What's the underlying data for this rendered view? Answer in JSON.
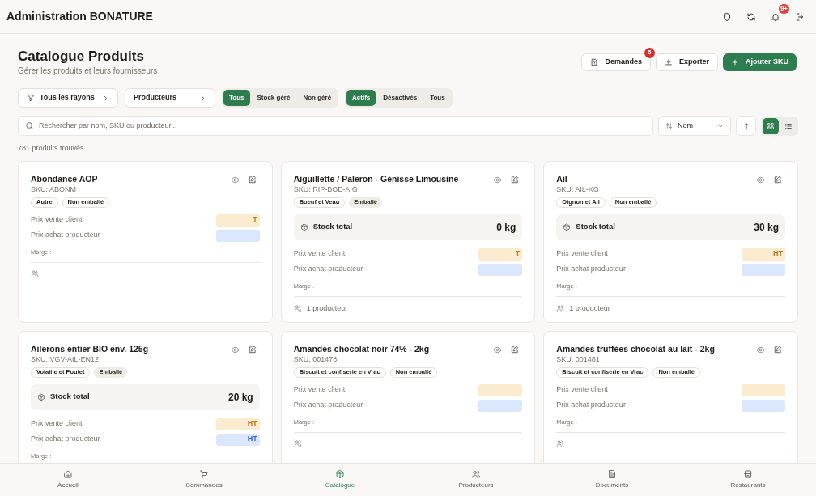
{
  "app_bar": {
    "title": "Administration BONATURE",
    "icons": [
      {
        "kind": "shield"
      },
      {
        "kind": "refresh"
      },
      {
        "kind": "bell",
        "badge": "9+"
      },
      {
        "kind": "logout"
      }
    ]
  },
  "page": {
    "title": "Catalogue Produits",
    "subtitle": "Gérer les produits et leurs fournisseurs"
  },
  "actions": [
    {
      "kind": "demandes",
      "label": "Demandes",
      "badge": "5"
    },
    {
      "kind": "export",
      "label": "Exporter"
    },
    {
      "kind": "add",
      "label": "Ajouter SKU"
    }
  ],
  "filters": {
    "dropdowns": [
      {
        "kind": "filter",
        "label": "Tous les rayons"
      },
      {
        "kind": "plain",
        "label": "Producteurs"
      }
    ],
    "stock_toggle": [
      {
        "label": "Tous",
        "selected": true
      },
      {
        "label": "Stock géré",
        "selected": false
      },
      {
        "label": "Non géré",
        "selected": false
      }
    ],
    "status_toggle": [
      {
        "label": "Actifs",
        "selected": true
      },
      {
        "label": "Désactivés",
        "selected": false
      },
      {
        "label": "Tous",
        "selected": false
      }
    ]
  },
  "search": {
    "placeholder": "Rechercher par nom, SKU ou producteur..."
  },
  "sort": {
    "value": "Nom"
  },
  "view": [
    {
      "kind": "grid",
      "selected": true
    },
    {
      "kind": "list",
      "selected": false
    }
  ],
  "result_count": "781 produits trouvés",
  "products": [
    {
      "name": "Abondance AOP",
      "sku": "SKU: ABONM",
      "tags": [
        {
          "label": "Autre",
          "kind": "outline"
        },
        {
          "label": "Non emballé",
          "kind": "outline"
        }
      ],
      "client_label": "Prix vente client",
      "client_price": "T",
      "producer_label": "Prix achat producteur",
      "margin": "Marge :"
    },
    {
      "name": "Aiguillette / Paleron - Génisse Limousine",
      "sku": "SKU: RIP-BOE-AIG",
      "tags": [
        {
          "label": "Boeuf et Veau",
          "kind": "outline"
        },
        {
          "label": "Emballé",
          "kind": "filled"
        }
      ],
      "stock_label": "Stock total",
      "stock": "0 kg",
      "client_label": "Prix vente client",
      "client_price": "T",
      "producer_label": "Prix achat producteur",
      "margin": "Marge .",
      "producers": "1 producteur"
    },
    {
      "name": "Ail",
      "sku": "SKU: AIL-KG",
      "tags": [
        {
          "label": "Oignon et Ail",
          "kind": "outline"
        },
        {
          "label": "Non emballé",
          "kind": "outline"
        }
      ],
      "stock_label": "Stock total",
      "stock": "30 kg",
      "client_label": "Prix vente client",
      "client_price": "HT",
      "producer_label": "Prix achat producteur",
      "margin": "Marge :",
      "producers": "1 producteur"
    },
    {
      "name": "Ailerons entier BIO env. 125g",
      "sku": "SKU: VGV-AIL-EN12",
      "tags": [
        {
          "label": "Volaille et Poulet",
          "kind": "outline"
        },
        {
          "label": "Emballé",
          "kind": "filled"
        }
      ],
      "stock_label": "Stock total",
      "stock": "20 kg",
      "client_label": "Prix vente client",
      "client_price": "HT",
      "producer_label": "Prix achat producteur",
      "producer_price": "HT",
      "margin": "Marge :"
    },
    {
      "name": "Amandes chocolat noir 74% - 2kg",
      "sku": "SKU: 001478",
      "tags": [
        {
          "label": "Biscuit et confiserie en Vrac",
          "kind": "outline"
        },
        {
          "label": "Non emballé",
          "kind": "outline"
        }
      ],
      "client_label": "Prix vente client",
      "producer_label": "Prix achat producteur",
      "margin": "Marge :"
    },
    {
      "name": "Amandes truffées chocolat au lait - 2kg",
      "sku": "SKU: 001481",
      "tags": [
        {
          "label": "Biscuit et confiserie en Vrac",
          "kind": "outline"
        },
        {
          "label": "Non emballé",
          "kind": "outline"
        }
      ],
      "client_label": "Prix vente client",
      "producer_label": "Prix achat producteur",
      "margin": "Marge :"
    }
  ],
  "bottom_nav": [
    {
      "kind": "home",
      "label": "Accueil",
      "selected": false
    },
    {
      "kind": "cart",
      "label": "Commandes",
      "selected": false
    },
    {
      "kind": "box",
      "label": "Catalogue",
      "selected": true
    },
    {
      "kind": "users",
      "label": "Producteurs",
      "selected": false
    },
    {
      "kind": "doc",
      "label": "Documents",
      "selected": false
    },
    {
      "kind": "store",
      "label": "Restaurants",
      "selected": false
    }
  ]
}
